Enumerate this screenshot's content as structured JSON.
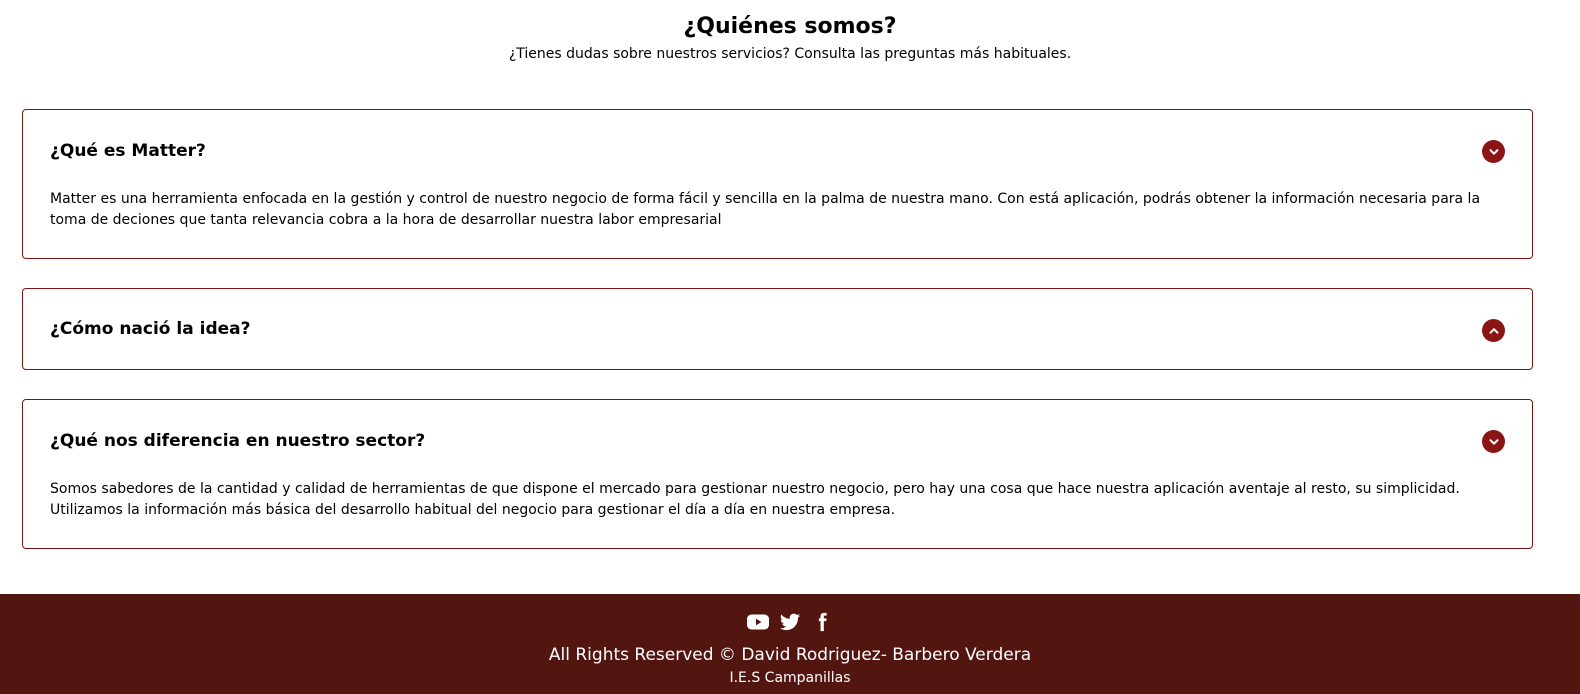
{
  "intro": {
    "title": "¿Quiénes somos?",
    "subtitle": "¿Tienes dudas sobre nuestros servicios? Consulta las preguntas más habituales."
  },
  "faq": [
    {
      "question": "¿Qué es Matter?",
      "answer": "Matter es una herramienta enfocada en la gestión y control de nuestro negocio de forma fácil y sencilla en la palma de nuestra mano. Con está aplicación, podrás obtener la información necesaria para la toma de deciones que tanta relevancia cobra a la hora de desarrollar nuestra labor empresarial",
      "expanded": true,
      "toggle_icon": "chevron-down-icon"
    },
    {
      "question": "¿Cómo nació la idea?",
      "answer": "",
      "expanded": false,
      "toggle_icon": "chevron-up-icon"
    },
    {
      "question": "¿Qué nos diferencia en nuestro sector?",
      "answer": "Somos sabedores de la cantidad y calidad de herramientas de que dispone el mercado para gestionar nuestro negocio, pero hay una cosa que hace nuestra aplicación aventaje al resto, su simplicidad. Utilizamos la información más básica del desarrollo habitual del negocio para gestionar el día a día en nuestra empresa.",
      "expanded": true,
      "toggle_icon": "chevron-down-icon"
    }
  ],
  "footer": {
    "social_icons": [
      "youtube-icon",
      "twitter-icon",
      "facebook-icon"
    ],
    "rights": "All Rights Reserved © David Rodriguez- Barbero Verdera",
    "school": "I.E.S Campanillas"
  },
  "colors": {
    "accent": "#8b1414",
    "border": "#7a1414",
    "footer_bg": "#521510"
  }
}
